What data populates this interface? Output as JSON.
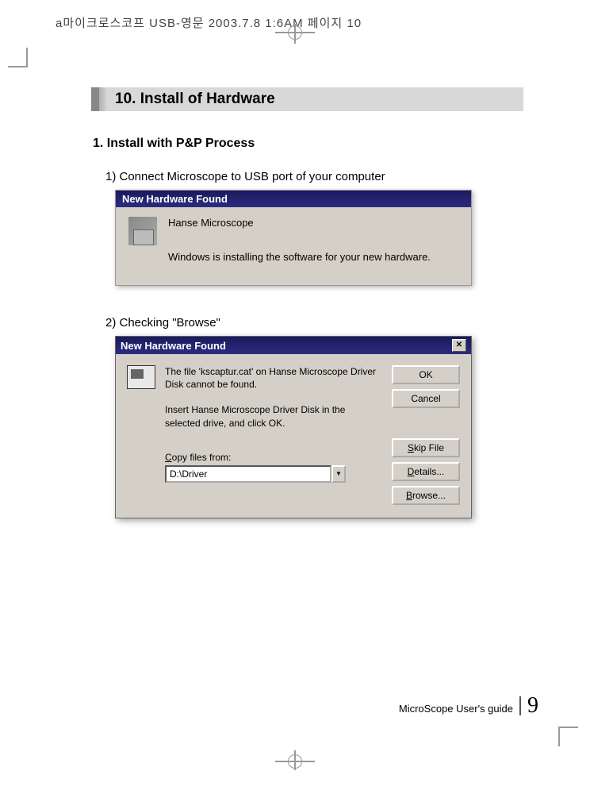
{
  "header_meta": "a마이크로스코프 USB-영문 2003.7.8 1:6AM 페이지 10",
  "section": {
    "number_title": "10. Install  of Hardware"
  },
  "subsection": {
    "title": "1. Install with P&P Process"
  },
  "steps": {
    "step1": "1) Connect Microscope to USB port of your computer",
    "step2": "2) Checking \"Browse\""
  },
  "dialog1": {
    "title": "New Hardware Found",
    "device_name": "Hanse Microscope",
    "message": "Windows is installing the software for your new hardware."
  },
  "dialog2": {
    "title": "New Hardware Found",
    "close_x": "✕",
    "msg1": "The file 'kscaptur.cat' on Hanse Microscope Driver Disk cannot be found.",
    "msg2": "Insert Hanse Microscope Driver Disk in the selected drive, and click OK.",
    "copy_label_prefix": "C",
    "copy_label_rest": "opy files from:",
    "dropdown_value": "D:\\Driver",
    "dropdown_arrow": "▼",
    "buttons": {
      "ok": "OK",
      "cancel": "Cancel",
      "skip_prefix": "S",
      "skip_rest": "kip File",
      "details_prefix": "D",
      "details_rest": "etails...",
      "browse_prefix": "B",
      "browse_rest": "rowse..."
    }
  },
  "footer": {
    "guide_text": "MicroScope User's guide",
    "page_num": "9"
  }
}
